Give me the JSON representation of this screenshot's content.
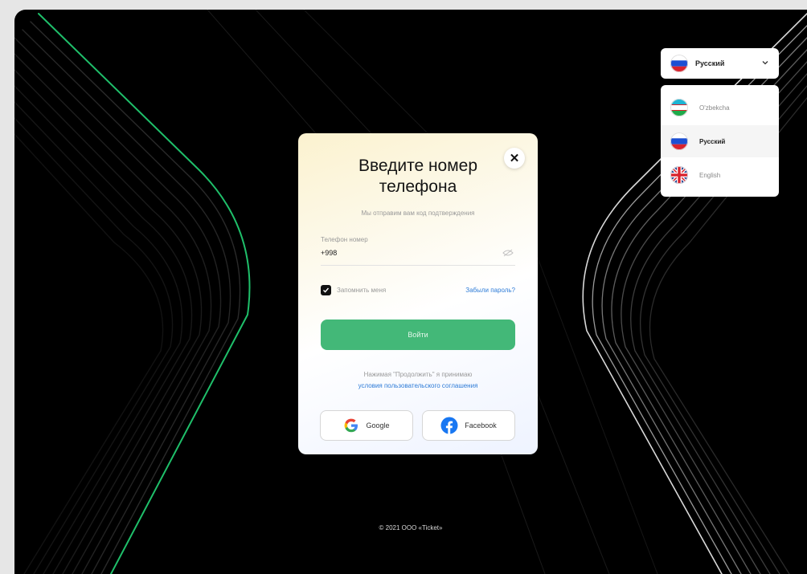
{
  "modal": {
    "title": "Введите номер телефона",
    "subtitle": "Мы отправим вам код подтверждения",
    "close_label": "✕",
    "phone_label": "Телефон номер",
    "phone_value": "+998",
    "remember_label": "Запомнить меня",
    "forgot_label": "Забыли пароль?",
    "login_label": "Войти",
    "terms_text": "Нажимая \"Продолжить\" я принимаю",
    "terms_link": "условия пользовательского соглашения",
    "google_label": "Google",
    "facebook_label": "Facebook"
  },
  "language": {
    "selected": "Русский",
    "options": [
      {
        "label": "O'zbekcha",
        "flag": "uz"
      },
      {
        "label": "Русский",
        "flag": "ru",
        "selected": true
      },
      {
        "label": "English",
        "flag": "gb"
      }
    ]
  },
  "footer": {
    "copyright": "© 2021 ООО «Ticket»"
  },
  "colors": {
    "primary": "#43b878",
    "link": "#2d7bd7",
    "background": "#000000",
    "accent_line": "#1fbf6a"
  }
}
